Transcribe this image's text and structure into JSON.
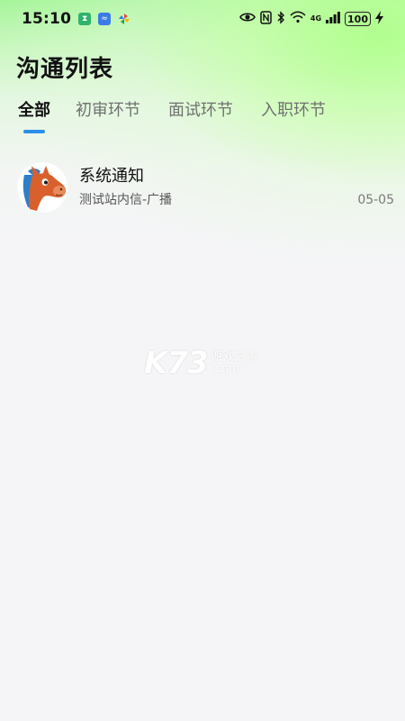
{
  "status_bar": {
    "time": "15:10",
    "network": "4G",
    "battery": "100",
    "icons": [
      "hourglass-app-icon",
      "wave-app-icon",
      "pinwheel-app-icon",
      "eye-icon",
      "nfc-icon",
      "bluetooth-icon",
      "wifi-icon",
      "signal-icon",
      "battery-icon",
      "charging-icon"
    ]
  },
  "page": {
    "title": "沟通列表"
  },
  "tabs": [
    {
      "label": "全部",
      "active": true
    },
    {
      "label": "初审环节",
      "active": false
    },
    {
      "label": "面试环节",
      "active": false
    },
    {
      "label": "入职环节",
      "active": false
    }
  ],
  "conversations": [
    {
      "title": "系统通知",
      "subtitle": "测试站内信-广播",
      "date": "05-05",
      "avatar": "horse-avatar"
    }
  ],
  "watermark": {
    "logo": "K73",
    "line1": "游戏之家",
    "line2": ".com"
  },
  "colors": {
    "accent": "#2c8ee6",
    "gradient_green": "#a6f59a",
    "background": "#f5f5f7"
  }
}
